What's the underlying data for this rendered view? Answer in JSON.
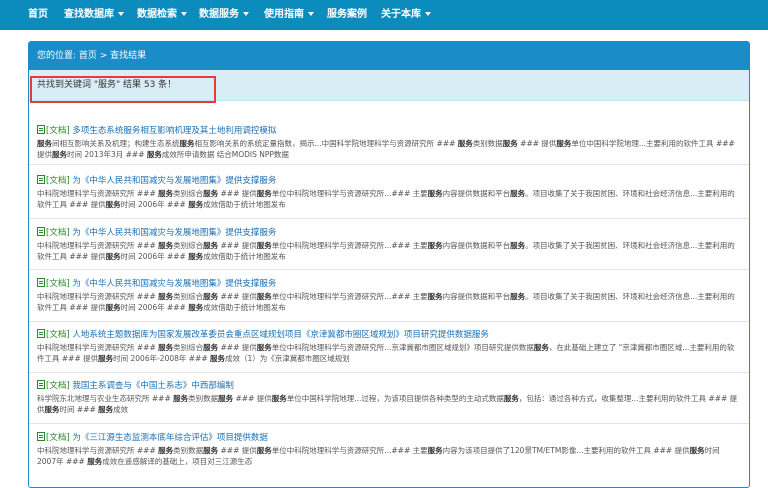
{
  "nav": [
    {
      "label": "首页",
      "dropdown": false
    },
    {
      "label": "查找数据库",
      "dropdown": true
    },
    {
      "label": "数据检索",
      "dropdown": true
    },
    {
      "label": "数据服务",
      "dropdown": true
    },
    {
      "label": "使用指南",
      "dropdown": true
    },
    {
      "label": "服务案例",
      "dropdown": false
    },
    {
      "label": "关于本库",
      "dropdown": true
    }
  ],
  "breadcrumb": "您的位置: 首页 > 查找结果",
  "summary": "共找到关键词 \"服务\" 结果 53 条！",
  "results": [
    {
      "tag": "[文档]",
      "title": "多项生态系统服务相互影响机理及其土地利用调控模拟",
      "desc": "服务间相互影响关系及机理；构建生态系统服务相互影响关系的系统定量指数，揭示...中国科学院地理科学与资源研究所 ### 服务类别数据服务 ### 提供服务单位中国科学院地理...主要利用的软件工具 ### 提供服务时间 2013年3月 ### 服务成效所申请数据 结合MODIS NPP数据"
    },
    {
      "tag": "[文档]",
      "title": "为《中华人民共和国减灾与发展地图集》提供支撑服务",
      "desc": "中科院地理科学与资源研究所 ### 服务类别综合服务 ### 提供服务单位中科院地理科学与资源研究所...### 主要服务内容提供数据和平台服务。项目收集了关于我国贫困、环境和社会经济信息...主要利用的软件工具 ### 提供服务时间 2006年 ### 服务成效借助于统计地图发布"
    },
    {
      "tag": "[文档]",
      "title": "为《中华人民共和国减灾与发展地图集》提供支撑服务",
      "desc": "中科院地理科学与资源研究所 ### 服务类别综合服务 ### 提供服务单位中科院地理科学与资源研究所...### 主要服务内容提供数据和平台服务。项目收集了关于我国贫困、环境和社会经济信息...主要利用的软件工具 ### 提供服务时间 2006年 ### 服务成效借助于统计地图发布"
    },
    {
      "tag": "[文档]",
      "title": "为《中华人民共和国减灾与发展地图集》提供支撑服务",
      "desc": "中科院地理科学与资源研究所 ### 服务类别综合服务 ### 提供服务单位中科院地理科学与资源研究所...### 主要服务内容提供数据和平台服务。项目收集了关于我国贫困、环境和社会经济信息...主要利用的软件工具 ### 提供服务时间 2006年 ### 服务成效借助于统计地图发布"
    },
    {
      "tag": "[文档]",
      "title": "人地系统主题数据库为国家发展改革委员会重点区域规划项目《京津冀都市圈区域规划》项目研究提供数据服务",
      "desc": "中科院地理科学与资源研究所 ### 服务类别综合服务 ### 提供服务单位中科院地理科学与资源研究所...京津冀都市圈区域规划》项目研究提供数据服务，在此基础上建立了 \"京津冀都市圈区域...主要利用的软件工具 ### 提供服务时间 2006年-2008年 ### 服务成效（1）为《京津冀都市圈区域规划"
    },
    {
      "tag": "[文档]",
      "title": "我国主系调查与《中国土系志》中西部编制",
      "desc": "科学院东北地理与农业生态研究所 ### 服务类别数据服务 ### 提供服务单位中国科学院地理...过程，为该项目提供各种类型的主动式数据服务，包括：通过各种方式，收集整理...主要利用的软件工具 ### 提供服务时间 ### 服务成效"
    },
    {
      "tag": "[文档]",
      "title": "为《三江源生态监测本底年综合评估》项目提供数据",
      "desc": "中科院地理科学与资源研究所 ### 服务类别数据服务 ### 提供服务单位中科院地理科学与资源研究所...### 主要服务内容为该项目提供了120景TM/ETM影像...主要利用的软件工具 ### 提供服务时间 2007年 ### 服务成效在遥感解译的基础上，项目对三江源生态"
    }
  ]
}
